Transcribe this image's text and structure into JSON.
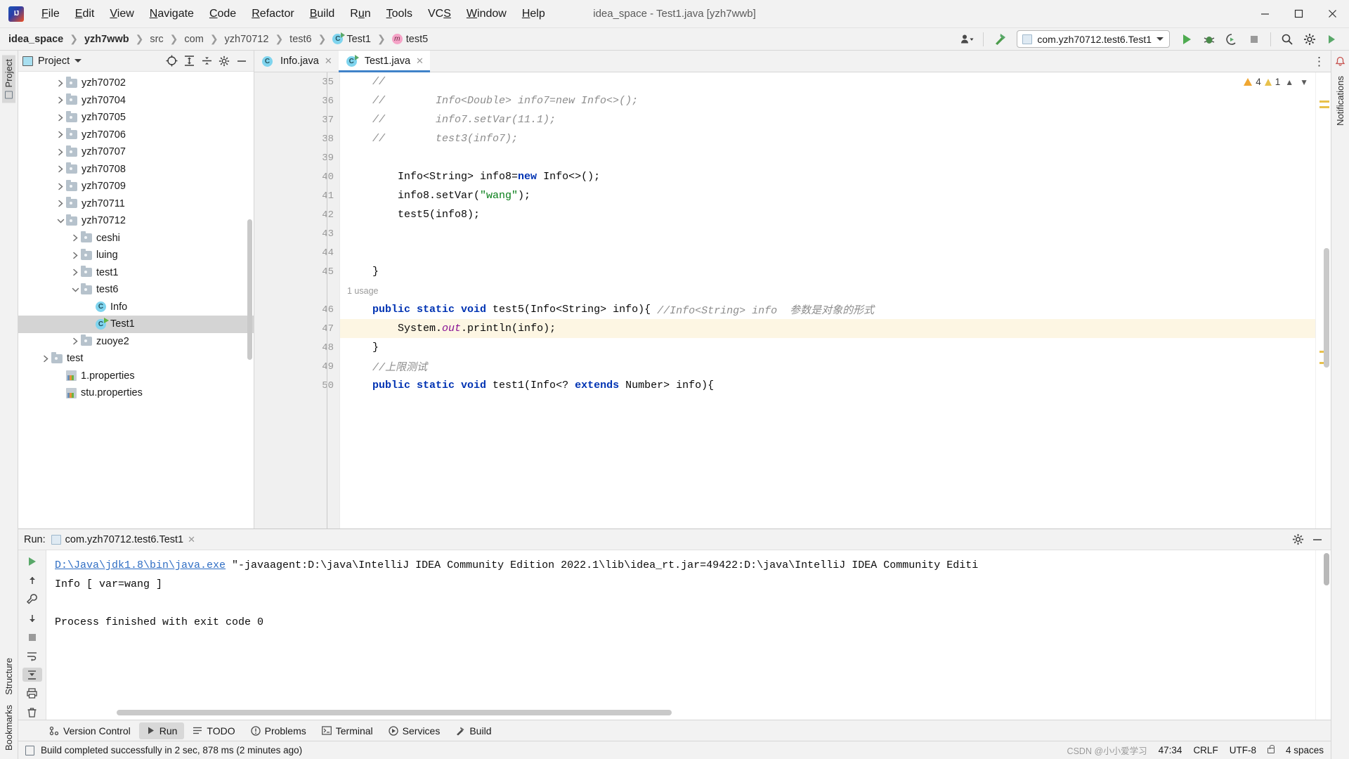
{
  "window": {
    "title": "idea_space - Test1.java [yzh7wwb]",
    "logo_icon": "intellij-idea-logo",
    "controls": {
      "minimize": "—",
      "maximize": "❐",
      "close": "✕"
    }
  },
  "menubar": {
    "items": [
      {
        "label": "File",
        "mnemonic": "F"
      },
      {
        "label": "Edit",
        "mnemonic": "E"
      },
      {
        "label": "View",
        "mnemonic": "V"
      },
      {
        "label": "Navigate",
        "mnemonic": "N"
      },
      {
        "label": "Code",
        "mnemonic": "C"
      },
      {
        "label": "Refactor",
        "mnemonic": "R"
      },
      {
        "label": "Build",
        "mnemonic": "B"
      },
      {
        "label": "Run",
        "mnemonic": "R"
      },
      {
        "label": "Tools",
        "mnemonic": "T"
      },
      {
        "label": "VCS",
        "mnemonic": "S"
      },
      {
        "label": "Window",
        "mnemonic": "W"
      },
      {
        "label": "Help",
        "mnemonic": "H"
      }
    ]
  },
  "navbar": {
    "crumbs": [
      {
        "label": "idea_space",
        "style": "bold",
        "icon": null
      },
      {
        "label": "yzh7wwb",
        "style": "bold",
        "icon": null
      },
      {
        "label": "src",
        "style": "dim",
        "icon": null
      },
      {
        "label": "com",
        "style": "dim",
        "icon": null
      },
      {
        "label": "yzh70712",
        "style": "dim",
        "icon": null
      },
      {
        "label": "test6",
        "style": "dim",
        "icon": null
      },
      {
        "label": "Test1",
        "style": "normal",
        "icon": "class-runnable-icon"
      },
      {
        "label": "test5",
        "style": "normal",
        "icon": "method-icon"
      }
    ],
    "run_config": "com.yzh70712.test6.Test1",
    "icons": {
      "user": "user-settings-icon",
      "hammer": "build-hammer-icon",
      "run": "run-icon",
      "debug": "debug-icon",
      "run_coverage": "run-with-coverage-icon",
      "stop": "stop-icon",
      "search": "search-icon",
      "settings": "settings-gear-icon",
      "updates": "run-anything-icon"
    }
  },
  "left_rail": {
    "top": [
      {
        "label": "Project",
        "icon": "project-panel-icon",
        "active": true
      }
    ],
    "bottom": [
      {
        "label": "Bookmarks",
        "icon": "bookmarks-icon"
      },
      {
        "label": "Structure",
        "icon": "structure-icon"
      }
    ]
  },
  "right_rail": {
    "items": [
      {
        "label": "Notifications",
        "icon": "notifications-bell-icon"
      }
    ]
  },
  "project_panel": {
    "title": "Project",
    "icons": {
      "panel": "project-view-icon",
      "dropdown": "chevron-down-icon",
      "locate": "select-opened-file-icon",
      "expand_all": "expand-all-icon",
      "collapse_all": "collapse-all-icon",
      "settings": "gear-icon",
      "hide": "hide-panel-icon"
    },
    "tree": [
      {
        "label": "yzh70702",
        "type": "folder",
        "indent": 2,
        "state": "collapsed"
      },
      {
        "label": "yzh70704",
        "type": "folder",
        "indent": 2,
        "state": "collapsed"
      },
      {
        "label": "yzh70705",
        "type": "folder",
        "indent": 2,
        "state": "collapsed"
      },
      {
        "label": "yzh70706",
        "type": "folder",
        "indent": 2,
        "state": "collapsed"
      },
      {
        "label": "yzh70707",
        "type": "folder",
        "indent": 2,
        "state": "collapsed"
      },
      {
        "label": "yzh70708",
        "type": "folder",
        "indent": 2,
        "state": "collapsed"
      },
      {
        "label": "yzh70709",
        "type": "folder",
        "indent": 2,
        "state": "collapsed"
      },
      {
        "label": "yzh70711",
        "type": "folder",
        "indent": 2,
        "state": "collapsed"
      },
      {
        "label": "yzh70712",
        "type": "folder",
        "indent": 2,
        "state": "expanded"
      },
      {
        "label": "ceshi",
        "type": "folder",
        "indent": 3,
        "state": "collapsed"
      },
      {
        "label": "luing",
        "type": "folder",
        "indent": 3,
        "state": "collapsed"
      },
      {
        "label": "test1",
        "type": "folder",
        "indent": 3,
        "state": "collapsed"
      },
      {
        "label": "test6",
        "type": "folder",
        "indent": 3,
        "state": "expanded"
      },
      {
        "label": "Info",
        "type": "class",
        "indent": 4,
        "state": "leaf"
      },
      {
        "label": "Test1",
        "type": "class-runnable",
        "indent": 4,
        "state": "leaf",
        "selected": true
      },
      {
        "label": "zuoye2",
        "type": "folder",
        "indent": 3,
        "state": "collapsed"
      },
      {
        "label": "test",
        "type": "folder",
        "indent": 1,
        "state": "collapsed"
      },
      {
        "label": "1.properties",
        "type": "properties",
        "indent": 2,
        "state": "leaf"
      },
      {
        "label": "stu.properties",
        "type": "properties",
        "indent": 2,
        "state": "leaf"
      }
    ]
  },
  "editor": {
    "tabs": [
      {
        "label": "Info.java",
        "icon": "java-class-icon",
        "active": false,
        "close": "✕"
      },
      {
        "label": "Test1.java",
        "icon": "java-runnable-class-icon",
        "active": true,
        "close": "✕"
      }
    ],
    "more_icon": "more-options-icon",
    "inspections": {
      "warnings": "4",
      "weak_warnings": "1",
      "up_icon": "⌃",
      "down_icon": "⌄"
    },
    "lines": [
      {
        "num": "35",
        "fold": null,
        "tokens": [
          {
            "t": "    //",
            "c": "cmt"
          }
        ]
      },
      {
        "num": "36",
        "fold": null,
        "tokens": [
          {
            "t": "    //        Info<Double> info7=new Info<>();",
            "c": "cmt"
          }
        ]
      },
      {
        "num": "37",
        "fold": null,
        "tokens": [
          {
            "t": "    //        info7.setVar(11.1);",
            "c": "cmt"
          }
        ]
      },
      {
        "num": "38",
        "fold": "top",
        "tokens": [
          {
            "t": "    //        test3(info7);",
            "c": "cmt"
          }
        ]
      },
      {
        "num": "39",
        "fold": null,
        "tokens": [
          {
            "t": "",
            "c": ""
          }
        ]
      },
      {
        "num": "40",
        "fold": null,
        "tokens": [
          {
            "t": "        Info<String> info8=",
            "c": ""
          },
          {
            "t": "new",
            "c": "kw"
          },
          {
            "t": " Info<>();",
            "c": ""
          }
        ]
      },
      {
        "num": "41",
        "fold": null,
        "tokens": [
          {
            "t": "        info8.setVar(",
            "c": ""
          },
          {
            "t": "\"wang\"",
            "c": "str"
          },
          {
            "t": ");",
            "c": ""
          }
        ]
      },
      {
        "num": "42",
        "fold": null,
        "tokens": [
          {
            "t": "        test5(info8);",
            "c": ""
          }
        ]
      },
      {
        "num": "43",
        "fold": null,
        "tokens": [
          {
            "t": "",
            "c": ""
          }
        ]
      },
      {
        "num": "44",
        "fold": null,
        "tokens": [
          {
            "t": "",
            "c": ""
          }
        ]
      },
      {
        "num": "45",
        "fold": "bottom",
        "tokens": [
          {
            "t": "    }",
            "c": ""
          }
        ]
      },
      {
        "num": "",
        "fold": null,
        "hint": "1 usage"
      },
      {
        "num": "46",
        "fold": "top",
        "tokens": [
          {
            "t": "    ",
            "c": ""
          },
          {
            "t": "public static void",
            "c": "kw"
          },
          {
            "t": " test5(Info<String> info){ ",
            "c": ""
          },
          {
            "t": "//Info<String> info  参数是对象的形式",
            "c": "cmt"
          }
        ]
      },
      {
        "num": "47",
        "fold": null,
        "highlight": true,
        "tokens": [
          {
            "t": "        System.",
            "c": ""
          },
          {
            "t": "out",
            "c": "fld"
          },
          {
            "t": ".println(info);",
            "c": ""
          }
        ]
      },
      {
        "num": "48",
        "fold": "bottom",
        "tokens": [
          {
            "t": "    }",
            "c": ""
          }
        ]
      },
      {
        "num": "49",
        "fold": null,
        "tokens": [
          {
            "t": "    //上限测试",
            "c": "cmt"
          }
        ]
      },
      {
        "num": "50",
        "fold": "top",
        "tokens": [
          {
            "t": "    ",
            "c": ""
          },
          {
            "t": "public static void",
            "c": "kw"
          },
          {
            "t": " test1(Info<? ",
            "c": ""
          },
          {
            "t": "extends",
            "c": "kw"
          },
          {
            "t": " Number> info){",
            "c": ""
          }
        ]
      }
    ]
  },
  "run_panel": {
    "label": "Run:",
    "tab_label": "com.yzh70712.test6.Test1",
    "tab_icon": "run-configuration-icon",
    "close_icon": "✕",
    "settings_icon": "gear-icon",
    "hide_icon": "hide-panel-icon",
    "toolbar": [
      {
        "icon": "rerun-icon",
        "name": "rerun-button"
      },
      {
        "icon": "up-arrow-icon",
        "name": "scroll-up-button"
      },
      {
        "icon": "wrench-icon",
        "name": "settings-wrench-button"
      },
      {
        "icon": "down-arrow-icon",
        "name": "scroll-down-button"
      },
      {
        "icon": "stop-icon",
        "name": "stop-button"
      },
      {
        "icon": "soft-wrap-icon",
        "name": "soft-wrap-button"
      },
      {
        "icon": "scroll-to-end-icon",
        "name": "scroll-to-end-button",
        "active": true
      },
      {
        "icon": "print-icon",
        "name": "print-button"
      },
      {
        "icon": "clear-all-icon",
        "name": "clear-all-button"
      },
      {
        "icon": "trash-icon",
        "name": "trash-button"
      }
    ],
    "console": [
      {
        "link": "D:\\Java\\jdk1.8\\bin\\java.exe",
        "text": " \"-javaagent:D:\\java\\IntelliJ IDEA Community Edition 2022.1\\lib\\idea_rt.jar=49422:D:\\java\\IntelliJ IDEA Community Editi"
      },
      {
        "link": null,
        "text": "Info [ var=wang ]"
      },
      {
        "link": null,
        "text": ""
      },
      {
        "link": null,
        "text": "Process finished with exit code 0"
      }
    ]
  },
  "bottom_tabs": [
    {
      "label": "Version Control",
      "icon": "version-control-icon",
      "active": false
    },
    {
      "label": "Run",
      "icon": "run-icon",
      "active": true
    },
    {
      "label": "TODO",
      "icon": "todo-icon",
      "active": false
    },
    {
      "label": "Problems",
      "icon": "problems-icon",
      "active": false
    },
    {
      "label": "Terminal",
      "icon": "terminal-icon",
      "active": false
    },
    {
      "label": "Services",
      "icon": "services-icon",
      "active": false
    },
    {
      "label": "Build",
      "icon": "build-hammer-icon",
      "active": false
    }
  ],
  "statusbar": {
    "message": "Build completed successfully in 2 sec, 878 ms (2 minutes ago)",
    "icon": "event-log-icon",
    "caret": "47:34",
    "line_separator": "CRLF",
    "encoding": "UTF-8",
    "indent": "4 spaces",
    "watermark": "CSDN @小小爱学习",
    "lock_icon": "lock-icon"
  },
  "colors": {
    "accent": "#4083c9",
    "keyword": "#0033b3",
    "string": "#067d17",
    "comment": "#8c8c8c",
    "field": "#871094",
    "warning": "#f0a732",
    "run_green": "#59a869",
    "selection": "#d4d4d4",
    "current_line": "#fdf6e3"
  }
}
